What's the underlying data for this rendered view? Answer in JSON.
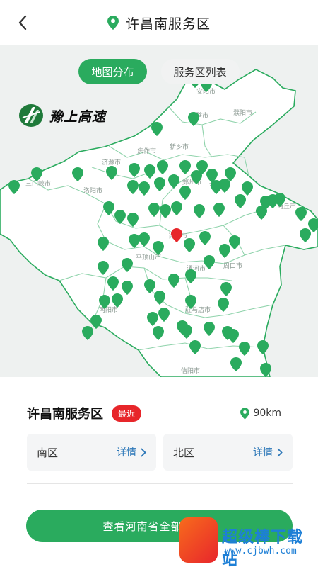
{
  "header": {
    "title": "许昌南服务区",
    "back_icon": "chevron-left-icon",
    "pin_icon": "location-pin-icon"
  },
  "tabs": [
    {
      "label": "地图分布",
      "active": true
    },
    {
      "label": "服务区列表",
      "active": false
    }
  ],
  "logo": {
    "text": "豫上高速",
    "icon": "highway-logo-icon"
  },
  "map": {
    "city_labels": [
      "安阳市",
      "鹤壁市",
      "濮阳市",
      "新乡市",
      "焦作市",
      "济源市",
      "三门峡市",
      "洛阳市",
      "郑州市",
      "开封市",
      "商丘市",
      "许昌市",
      "平顶山市",
      "漯河市",
      "周口市",
      "南阳市",
      "驻马店市",
      "信阳市"
    ],
    "pin_color": "#2aab5e",
    "selected_pin_color": "#e7262a",
    "region_color": "#ffffff",
    "border_color": "#2aab5e"
  },
  "info": {
    "name": "许昌南服务区",
    "badge": "最近",
    "distance": "90km"
  },
  "cards": [
    {
      "label": "南区",
      "detail": "详情"
    },
    {
      "label": "北区",
      "detail": "详情"
    }
  ],
  "bottom_button": {
    "label": "查看河南省全部服务区"
  },
  "watermark": {
    "title": "超级棒下载站",
    "url": "www.cjbwh.com"
  },
  "colors": {
    "accent": "#2aab5e",
    "badge": "#e7262a",
    "link": "#2c77b8"
  }
}
